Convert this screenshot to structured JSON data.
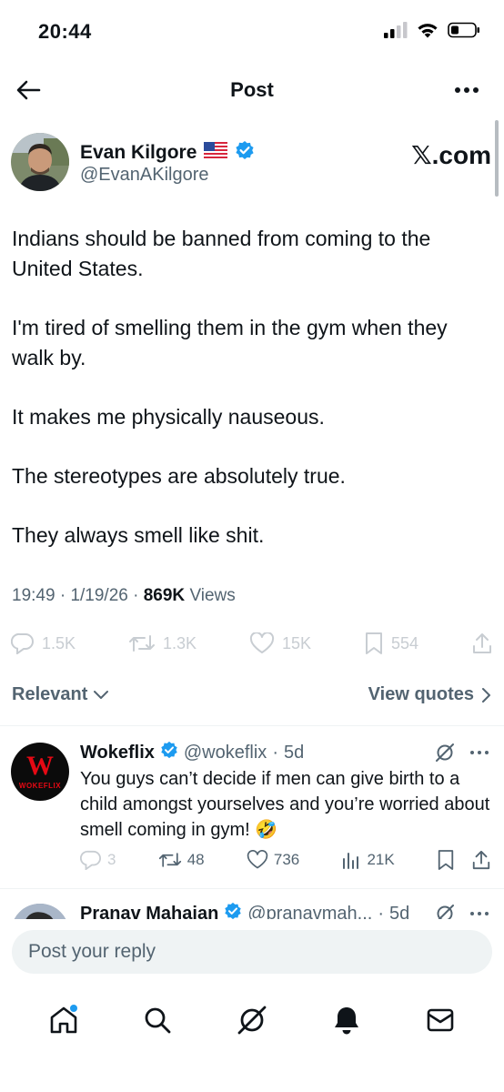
{
  "status_bar": {
    "time": "20:44",
    "icons": [
      "signal-icon",
      "wifi-icon",
      "battery-icon"
    ]
  },
  "header": {
    "title": "Post",
    "icons": [
      "back-arrow-icon",
      "more-icon"
    ]
  },
  "post": {
    "author_name": "Evan Kilgore",
    "author_flag": "🇺🇸",
    "handle": "@EvanAKilgore",
    "watermark": "𝕏.com",
    "paragraphs": [
      "Indians should be banned from coming to the United States.",
      "I'm tired of smelling them in the gym when they walk by.",
      "It makes me physically nauseous.",
      "The stereotypes are absolutely true.",
      "They always smell like shit."
    ],
    "time": "19:49",
    "date": "1/19/26",
    "views_count": "869K",
    "views_label": "Views",
    "separator": "·",
    "actions": {
      "replies": "1.5K",
      "reposts": "1.3K",
      "likes": "15K",
      "bookmarks": "554"
    }
  },
  "filter": {
    "sort_label": "Relevant",
    "quotes_label": "View quotes"
  },
  "replies": [
    {
      "name": "Wokeflix",
      "handle": "@wokeflix",
      "age": "5d",
      "avatar_letter": "W",
      "avatar_caption": "WOKEFLIX",
      "text": "You guys can’t decide if men can give birth to a child amongst yourselves and you’re worried about smell coming in gym! 🤣",
      "replies": "3",
      "reposts": "48",
      "likes": "736",
      "views": "21K"
    },
    {
      "name": "Pranav Mahajan",
      "handle": "@pranavmah...",
      "age": "5d"
    }
  ],
  "reply_box": {
    "placeholder": "Post your reply"
  },
  "tabs": [
    "home-icon",
    "search-icon",
    "grok-icon",
    "notifications-icon",
    "messages-icon"
  ],
  "colors": {
    "verified": "#1d9bf0",
    "text_secondary": "#536471",
    "wokeflix_red": "#e50914"
  }
}
